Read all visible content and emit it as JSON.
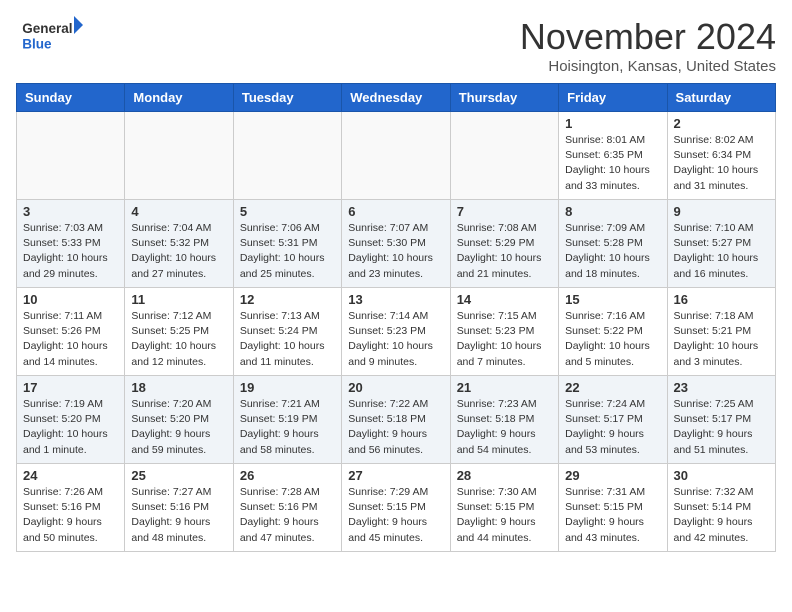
{
  "header": {
    "logo_line1": "General",
    "logo_line2": "Blue",
    "month": "November 2024",
    "location": "Hoisington, Kansas, United States"
  },
  "weekdays": [
    "Sunday",
    "Monday",
    "Tuesday",
    "Wednesday",
    "Thursday",
    "Friday",
    "Saturday"
  ],
  "weeks": [
    [
      {
        "day": "",
        "info": ""
      },
      {
        "day": "",
        "info": ""
      },
      {
        "day": "",
        "info": ""
      },
      {
        "day": "",
        "info": ""
      },
      {
        "day": "",
        "info": ""
      },
      {
        "day": "1",
        "info": "Sunrise: 8:01 AM\nSunset: 6:35 PM\nDaylight: 10 hours\nand 33 minutes."
      },
      {
        "day": "2",
        "info": "Sunrise: 8:02 AM\nSunset: 6:34 PM\nDaylight: 10 hours\nand 31 minutes."
      }
    ],
    [
      {
        "day": "3",
        "info": "Sunrise: 7:03 AM\nSunset: 5:33 PM\nDaylight: 10 hours\nand 29 minutes."
      },
      {
        "day": "4",
        "info": "Sunrise: 7:04 AM\nSunset: 5:32 PM\nDaylight: 10 hours\nand 27 minutes."
      },
      {
        "day": "5",
        "info": "Sunrise: 7:06 AM\nSunset: 5:31 PM\nDaylight: 10 hours\nand 25 minutes."
      },
      {
        "day": "6",
        "info": "Sunrise: 7:07 AM\nSunset: 5:30 PM\nDaylight: 10 hours\nand 23 minutes."
      },
      {
        "day": "7",
        "info": "Sunrise: 7:08 AM\nSunset: 5:29 PM\nDaylight: 10 hours\nand 21 minutes."
      },
      {
        "day": "8",
        "info": "Sunrise: 7:09 AM\nSunset: 5:28 PM\nDaylight: 10 hours\nand 18 minutes."
      },
      {
        "day": "9",
        "info": "Sunrise: 7:10 AM\nSunset: 5:27 PM\nDaylight: 10 hours\nand 16 minutes."
      }
    ],
    [
      {
        "day": "10",
        "info": "Sunrise: 7:11 AM\nSunset: 5:26 PM\nDaylight: 10 hours\nand 14 minutes."
      },
      {
        "day": "11",
        "info": "Sunrise: 7:12 AM\nSunset: 5:25 PM\nDaylight: 10 hours\nand 12 minutes."
      },
      {
        "day": "12",
        "info": "Sunrise: 7:13 AM\nSunset: 5:24 PM\nDaylight: 10 hours\nand 11 minutes."
      },
      {
        "day": "13",
        "info": "Sunrise: 7:14 AM\nSunset: 5:23 PM\nDaylight: 10 hours\nand 9 minutes."
      },
      {
        "day": "14",
        "info": "Sunrise: 7:15 AM\nSunset: 5:23 PM\nDaylight: 10 hours\nand 7 minutes."
      },
      {
        "day": "15",
        "info": "Sunrise: 7:16 AM\nSunset: 5:22 PM\nDaylight: 10 hours\nand 5 minutes."
      },
      {
        "day": "16",
        "info": "Sunrise: 7:18 AM\nSunset: 5:21 PM\nDaylight: 10 hours\nand 3 minutes."
      }
    ],
    [
      {
        "day": "17",
        "info": "Sunrise: 7:19 AM\nSunset: 5:20 PM\nDaylight: 10 hours\nand 1 minute."
      },
      {
        "day": "18",
        "info": "Sunrise: 7:20 AM\nSunset: 5:20 PM\nDaylight: 9 hours\nand 59 minutes."
      },
      {
        "day": "19",
        "info": "Sunrise: 7:21 AM\nSunset: 5:19 PM\nDaylight: 9 hours\nand 58 minutes."
      },
      {
        "day": "20",
        "info": "Sunrise: 7:22 AM\nSunset: 5:18 PM\nDaylight: 9 hours\nand 56 minutes."
      },
      {
        "day": "21",
        "info": "Sunrise: 7:23 AM\nSunset: 5:18 PM\nDaylight: 9 hours\nand 54 minutes."
      },
      {
        "day": "22",
        "info": "Sunrise: 7:24 AM\nSunset: 5:17 PM\nDaylight: 9 hours\nand 53 minutes."
      },
      {
        "day": "23",
        "info": "Sunrise: 7:25 AM\nSunset: 5:17 PM\nDaylight: 9 hours\nand 51 minutes."
      }
    ],
    [
      {
        "day": "24",
        "info": "Sunrise: 7:26 AM\nSunset: 5:16 PM\nDaylight: 9 hours\nand 50 minutes."
      },
      {
        "day": "25",
        "info": "Sunrise: 7:27 AM\nSunset: 5:16 PM\nDaylight: 9 hours\nand 48 minutes."
      },
      {
        "day": "26",
        "info": "Sunrise: 7:28 AM\nSunset: 5:16 PM\nDaylight: 9 hours\nand 47 minutes."
      },
      {
        "day": "27",
        "info": "Sunrise: 7:29 AM\nSunset: 5:15 PM\nDaylight: 9 hours\nand 45 minutes."
      },
      {
        "day": "28",
        "info": "Sunrise: 7:30 AM\nSunset: 5:15 PM\nDaylight: 9 hours\nand 44 minutes."
      },
      {
        "day": "29",
        "info": "Sunrise: 7:31 AM\nSunset: 5:15 PM\nDaylight: 9 hours\nand 43 minutes."
      },
      {
        "day": "30",
        "info": "Sunrise: 7:32 AM\nSunset: 5:14 PM\nDaylight: 9 hours\nand 42 minutes."
      }
    ]
  ]
}
